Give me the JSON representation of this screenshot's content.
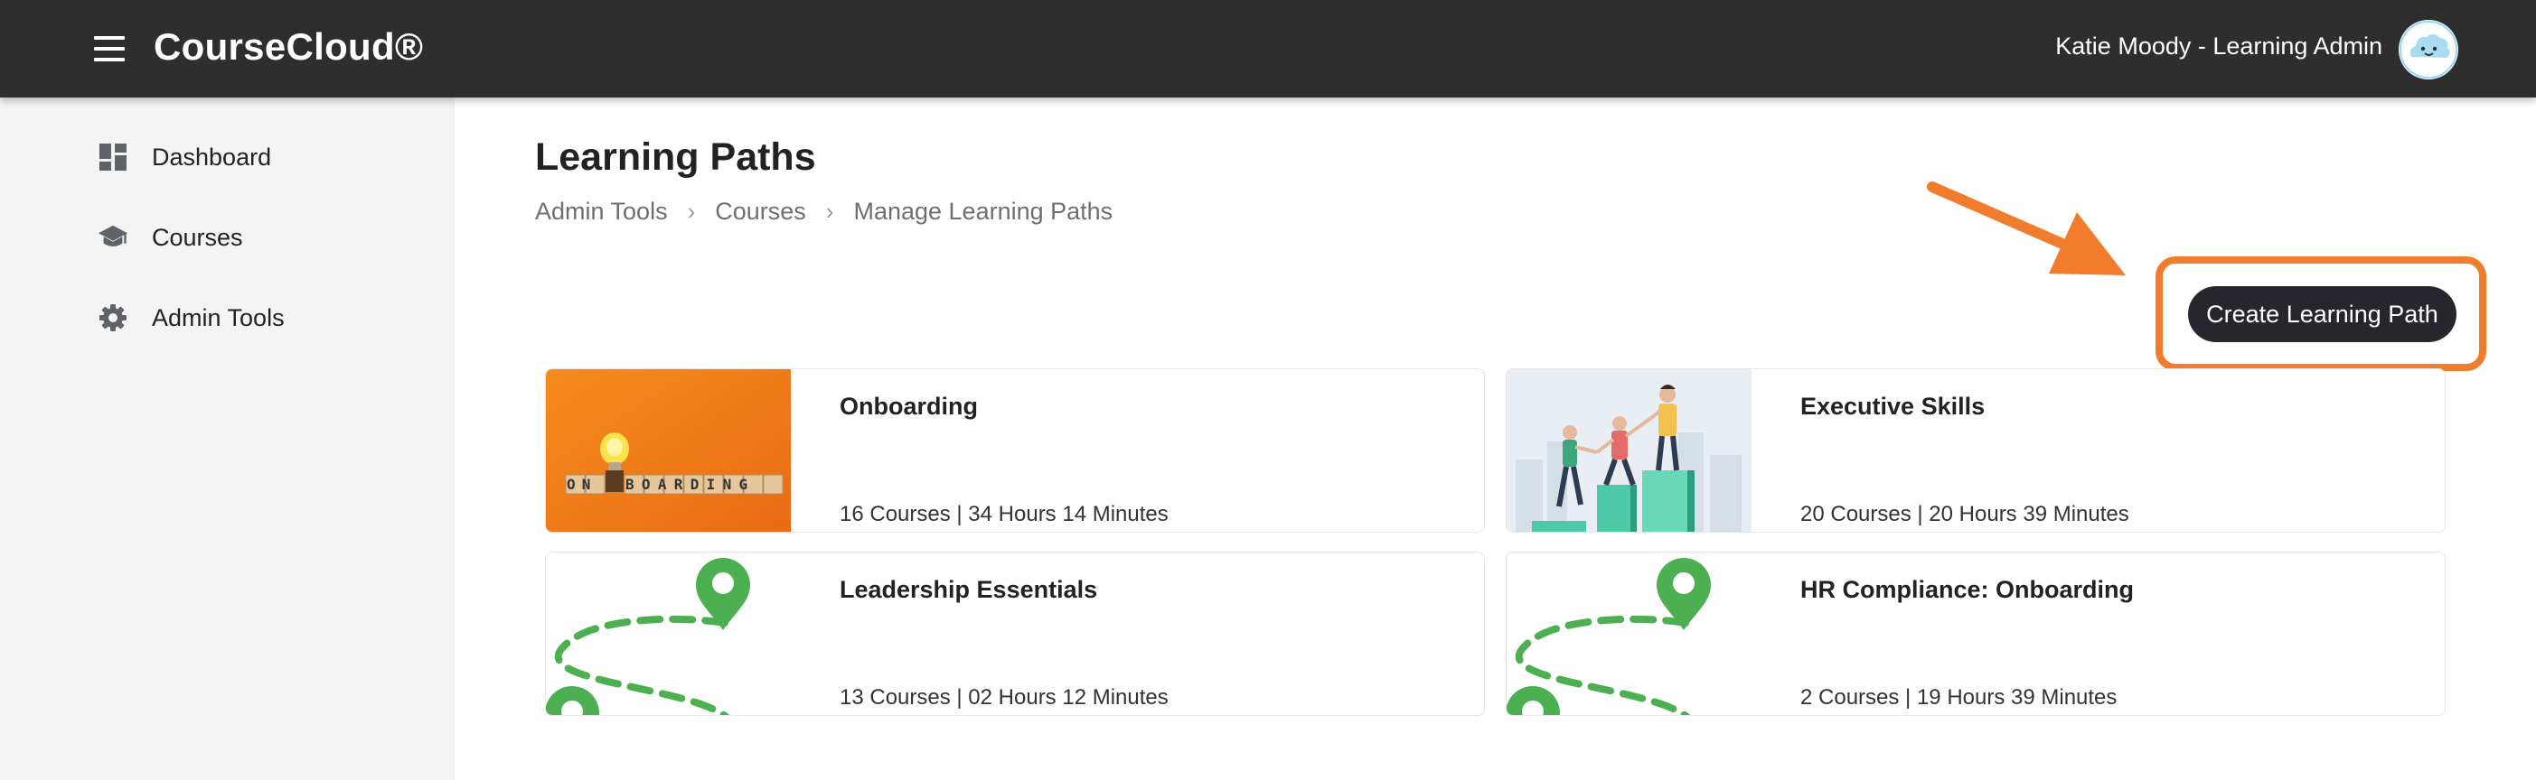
{
  "header": {
    "app_name": "CourseCloud®",
    "user_label": "Katie Moody - Learning Admin"
  },
  "sidebar": {
    "items": [
      {
        "label": "Dashboard",
        "icon": "dashboard-icon"
      },
      {
        "label": "Courses",
        "icon": "graduation-cap-icon"
      },
      {
        "label": "Admin Tools",
        "icon": "gear-icon"
      }
    ]
  },
  "main": {
    "title": "Learning Paths",
    "breadcrumb": [
      "Admin Tools",
      "Courses",
      "Manage Learning Paths"
    ],
    "create_button": "Create Learning Path",
    "cards": [
      {
        "title": "Onboarding",
        "meta": "16 Courses | 34 Hours 14 Minutes",
        "image": "onboarding-blocks-lightbulb"
      },
      {
        "title": "Executive Skills",
        "meta": "20 Courses | 20 Hours 39 Minutes",
        "image": "people-climbing-steps"
      },
      {
        "title": "Leadership Essentials",
        "meta": "13 Courses | 02 Hours 12 Minutes",
        "image": "map-pin-path"
      },
      {
        "title": "HR Compliance: Onboarding",
        "meta": "2 Courses | 19 Hours 39 Minutes",
        "image": "map-pin-path"
      }
    ],
    "thumb_text": {
      "before": "ON",
      "after": "BOARDING"
    }
  },
  "colors": {
    "topbar": "#2e2e2e",
    "sidebar": "#f4f4f4",
    "button": "#26262c",
    "annotation": "#f07c2c",
    "path_green": "#4caf50"
  }
}
